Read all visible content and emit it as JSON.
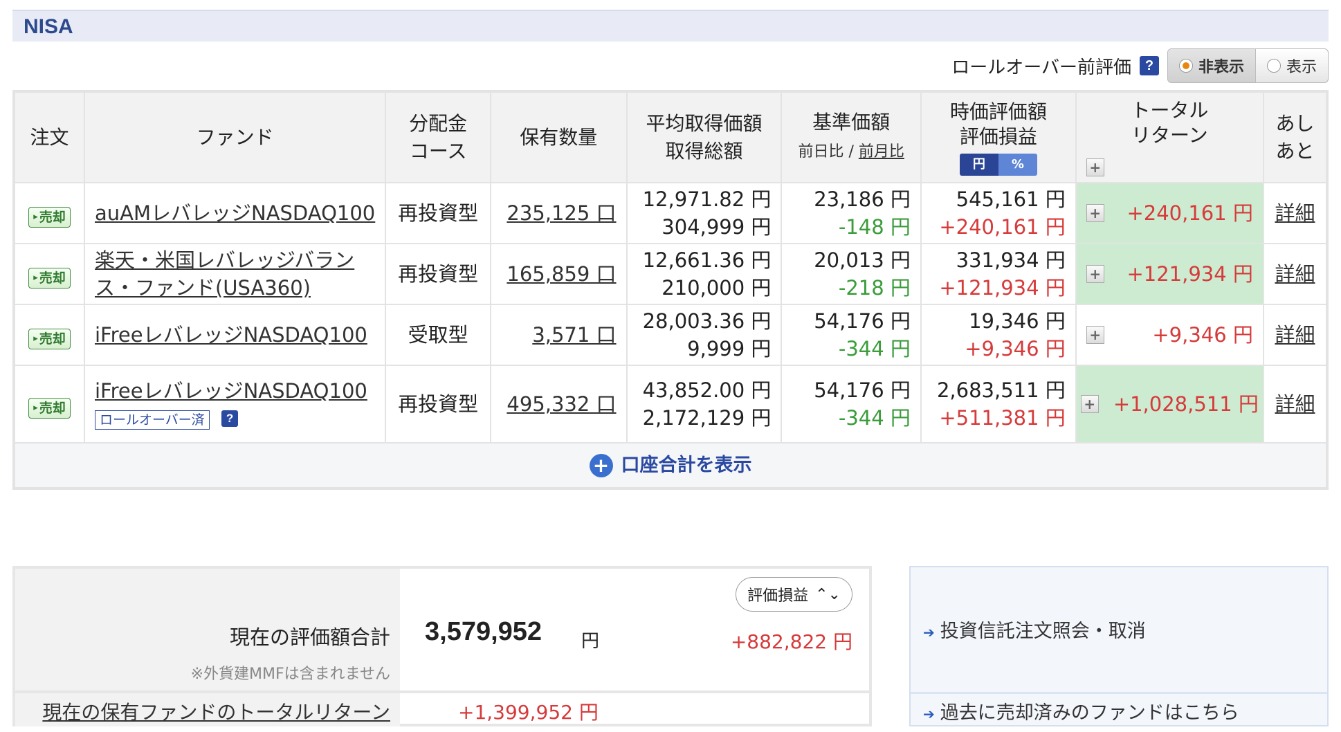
{
  "section_title": "NISA",
  "rollover": {
    "label": "ロールオーバー前評価",
    "options": [
      "非表示",
      "表示"
    ],
    "selected": "非表示"
  },
  "table": {
    "headers": {
      "order": "注文",
      "fund": "ファンド",
      "dist_1": "分配金",
      "dist_2": "コース",
      "qty": "保有数量",
      "avg_1": "平均取得価額",
      "avg_2": "取得総額",
      "base_1": "基準価額",
      "base_day": "前日比",
      "base_sep": "/",
      "base_month": "前月比",
      "eval_1": "時価評価額",
      "eval_2": "評価損益",
      "unit_yen": "円",
      "unit_pct": "%",
      "total_1": "トータル",
      "total_2": "リターン",
      "ashi_1": "あし",
      "ashi_2": "あと"
    },
    "sell_label": "売却",
    "detail_label": "詳細",
    "rows": [
      {
        "fund_name": "auAMレバレッジNASDAQ100",
        "course": "再投資型",
        "quantity": "235,125 口",
        "avg_price": "12,971.82 円",
        "total_cost": "304,999 円",
        "base_price": "23,186 円",
        "base_change": "-148 円",
        "market_value": "545,161 円",
        "unrealized": "+240,161 円",
        "total_return": "+240,161 円"
      },
      {
        "fund_name": "楽天・米国レバレッジバランス・ファンド(USA360)",
        "course": "再投資型",
        "quantity": "165,859 口",
        "avg_price": "12,661.36 円",
        "total_cost": "210,000 円",
        "base_price": "20,013 円",
        "base_change": "-218 円",
        "market_value": "331,934 円",
        "unrealized": "+121,934 円",
        "total_return": "+121,934 円"
      },
      {
        "fund_name": "iFreeレバレッジNASDAQ100",
        "course": "受取型",
        "quantity": "3,571 口",
        "avg_price": "28,003.36 円",
        "total_cost": "9,999 円",
        "base_price": "54,176 円",
        "base_change": "-344 円",
        "market_value": "19,346 円",
        "unrealized": "+9,346 円",
        "total_return": "+9,346 円"
      },
      {
        "fund_name": "iFreeレバレッジNASDAQ100",
        "course": "再投資型",
        "quantity": "495,332 口",
        "avg_price": "43,852.00 円",
        "total_cost": "2,172,129 円",
        "base_price": "54,176 円",
        "base_change": "-344 円",
        "market_value": "2,683,511 円",
        "unrealized": "+511,381 円",
        "total_return": "+1,028,511 円",
        "badge": "ロールオーバー済"
      }
    ],
    "show_total_label": "口座合計を表示"
  },
  "summary": {
    "select_label": "評価損益",
    "total_label": "現在の評価額合計",
    "note": "※外貨建MMFは含まれません",
    "total_value": "3,579,952",
    "unit": "円",
    "gain": "+882,822 円",
    "return_label": "現在の保有ファンドのトータルリターン",
    "return_value": "+1,399,952 円"
  },
  "links": {
    "order_inquiry": "投資信託注文照会・取消",
    "sold_funds": "過去に売却済みのファンドはこちら"
  },
  "colors": {
    "positive": "#d63a3a",
    "negative": "#3a9c3a",
    "total_bg": "#cdebd0",
    "accent": "#2a49a0"
  }
}
